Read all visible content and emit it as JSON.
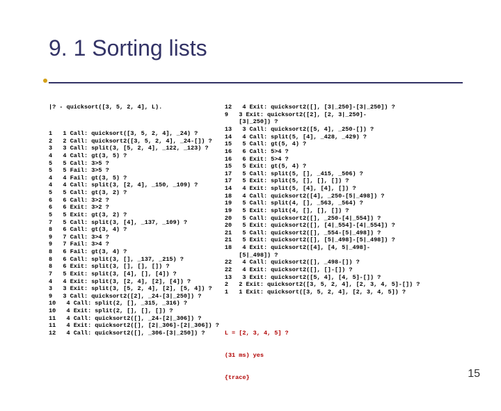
{
  "title": "9. 1 Sorting lists",
  "page_num": "15",
  "query": "|? - quicksort([3, 5, 2, 4], L).",
  "result_line1": "L = [2, 3, 4, 5] ?",
  "result_line2": "(31 ms) yes",
  "result_line3": "{trace}",
  "left": [
    "1   1 Call: quicksort([3, 5, 2, 4], _24) ?",
    "2   2 Call: quicksort2([3, 5, 2, 4], _24-[]) ?",
    "3   3 Call: split(3, [5, 2, 4], _122, _123) ?",
    "4   4 Call: gt(3, 5) ?",
    "5   5 Call: 3>5 ?",
    "5   5 Fail: 3>5 ?",
    "4   4 Fail: gt(3, 5) ?",
    "4   4 Call: split(3, [2, 4], _150, _109) ?",
    "5   5 Call: gt(3, 2) ?",
    "6   6 Call: 3>2 ?",
    "6   6 Exit: 3>2 ?",
    "5   5 Exit: gt(3, 2) ?",
    "7   5 Call: split(3, [4], _137, _109) ?",
    "8   6 Call: gt(3, 4) ?",
    "9   7 Call: 3>4 ?",
    "9   7 Fail: 3>4 ?",
    "8   6 Fail: gt(3, 4) ?",
    "8   6 Call: split(3, [], _137, _215) ?",
    "8   6 Exit: split(3, [], [], []) ?",
    "7   5 Exit: split(3, [4], [], [4]) ?",
    "4   4 Exit: split(3, [2, 4], [2], [4]) ?",
    "3   3 Exit: split(3, [5, 2, 4], [2], [5, 4]) ?",
    "9   3 Call: quicksort2([2], _24-[3|_250]) ?",
    "10   4 Call: split(2, [], _315, _316) ?",
    "10   4 Exit: split(2, [], [], []) ?",
    "11   4 Call: quicksort2([], _24-[2|_306]) ?",
    "11   4 Exit: quicksort2([], [2|_306]-[2|_306]) ?",
    "12   4 Call: quicksort2([], _306-[3|_250]) ?"
  ],
  "right": [
    "12   4 Exit: quicksort2([], [3|_250]-[3|_250]) ?",
    "9   3 Exit: quicksort2([2], [2, 3|_250]-",
    "    [3|_250]) ?",
    "13   3 Call: quicksort2([5, 4], _250-[]) ?",
    "14   4 Call: split(5, [4], _428, _429) ?",
    "15   5 Call: gt(5, 4) ?",
    "16   6 Call: 5>4 ?",
    "16   6 Exit: 5>4 ?",
    "15   5 Exit: gt(5, 4) ?",
    "17   5 Call: split(5, [], _415, _506) ?",
    "17   5 Exit: split(5, [], [], []) ?",
    "14   4 Exit: split(5, [4], [4], []) ?",
    "18   4 Call: quicksort2([4], _250-[5|_498]) ?",
    "19   5 Call: split(4, [], _563, _564) ?",
    "19   5 Exit: split(4, [], [], []) ?",
    "20   5 Call: quicksort2([], _250-[4|_554]) ?",
    "20   5 Exit: quicksort2([], [4|_554]-[4|_554]) ?",
    "21   5 Call: quicksort2([], _554-[5|_498]) ?",
    "21   5 Exit: quicksort2([], [5|_498]-[5|_498]) ?",
    "18   4 Exit: quicksort2([4], [4, 5|_498]-",
    "    [5|_498]) ?",
    "22   4 Call: quicksort2([], _498-[]) ?",
    "22   4 Exit: quicksort2([], []-[]) ?",
    "13   3 Exit: quicksort2([5, 4], [4, 5]-[]) ?",
    "2   2 Exit: quicksort2([3, 5, 2, 4], [2, 3, 4, 5]-[]) ?",
    "1   1 Exit: quicksort([3, 5, 2, 4], [2, 3, 4, 5]) ?"
  ]
}
